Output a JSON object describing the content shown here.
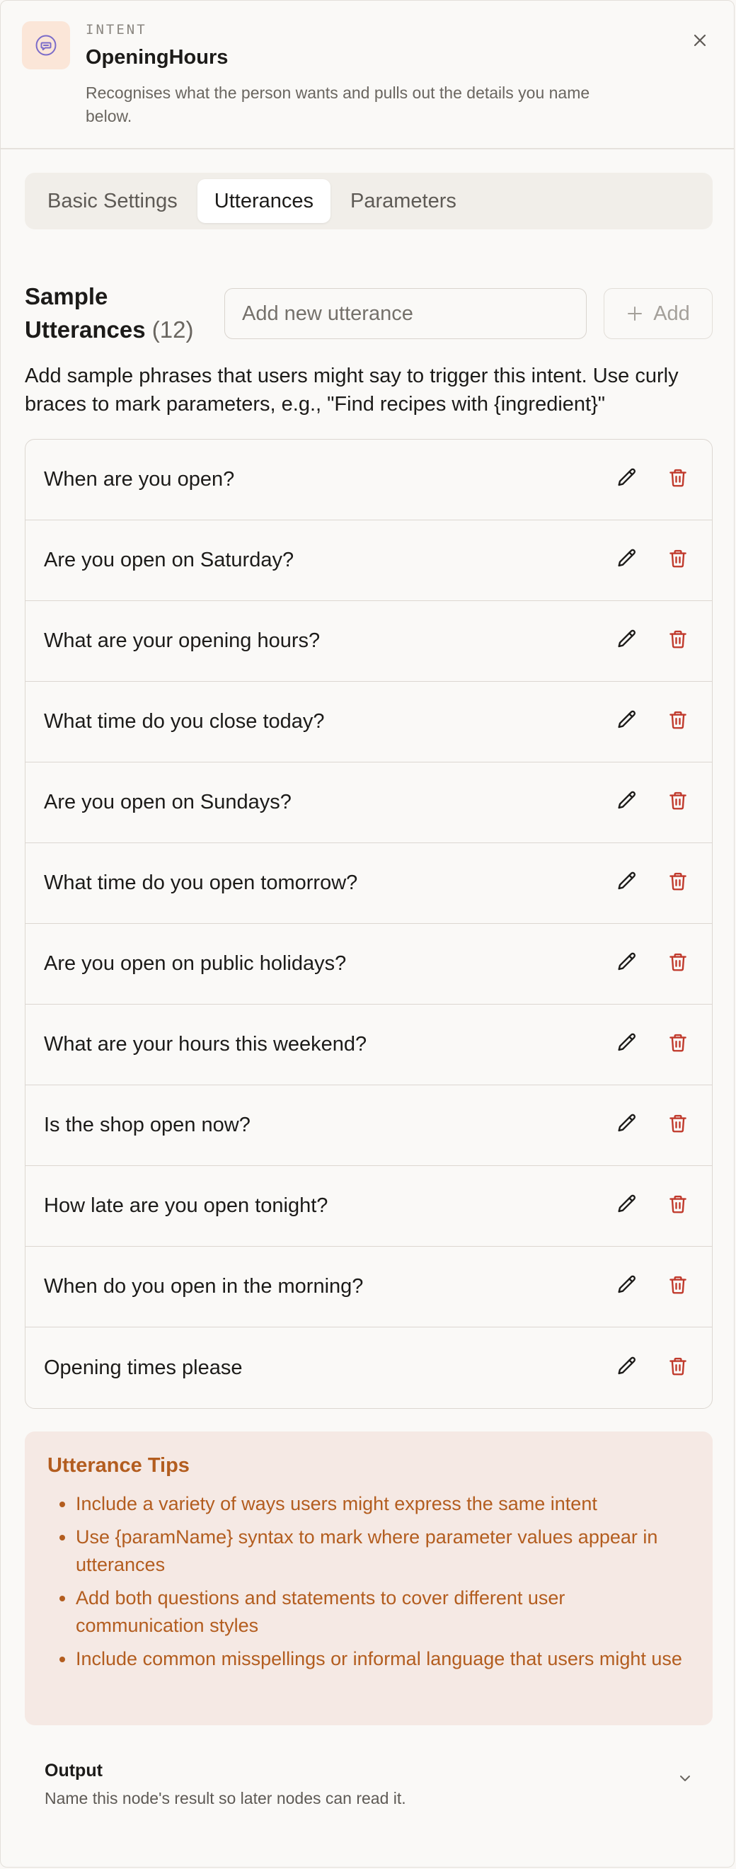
{
  "header": {
    "eyebrow": "INTENT",
    "title": "OpeningHours",
    "description": "Recognises what the person wants and pulls out the details you name below.",
    "icon": "chat-bubble-icon",
    "close_icon": "close-icon"
  },
  "tabs": [
    {
      "label": "Basic Settings",
      "active": false
    },
    {
      "label": "Utterances",
      "active": true
    },
    {
      "label": "Parameters",
      "active": false
    }
  ],
  "utterances_section": {
    "title": "Sample Utterances",
    "count": "(12)",
    "input_placeholder": "Add new utterance",
    "input_value": "",
    "add_label": "Add",
    "help": "Add sample phrases that users might say to trigger this intent. Use curly braces to mark parameters, e.g., \"Find recipes with {ingredient}\"",
    "items": [
      "When are you open?",
      "Are you open on Saturday?",
      "What are your opening hours?",
      "What time do you close today?",
      "Are you open on Sundays?",
      "What time do you open tomorrow?",
      "Are you open on public holidays?",
      "What are your hours this weekend?",
      "Is the shop open now?",
      "How late are you open tonight?",
      "When do you open in the morning?",
      "Opening times please"
    ]
  },
  "tips": {
    "title": "Utterance Tips",
    "items": [
      "Include a variety of ways users might express the same intent",
      "Use {paramName} syntax to mark where parameter values appear in utterances",
      "Add both questions and statements to cover different user communication styles",
      "Include common misspellings or informal language that users might use"
    ]
  },
  "output": {
    "title": "Output",
    "description": "Name this node's result so later nodes can read it."
  },
  "colors": {
    "accent_orange": "#b35d1f",
    "delete_red": "#c0392b",
    "icon_purple": "#7b6bc9",
    "tips_background": "#f5e9e4"
  }
}
